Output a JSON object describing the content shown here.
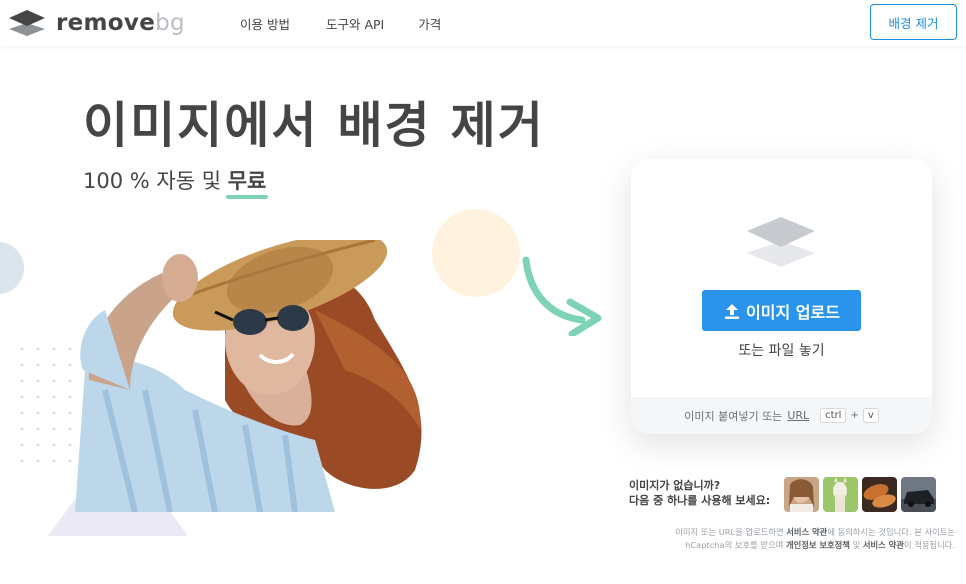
{
  "header": {
    "logo": {
      "word1": "remove",
      "word2": "bg"
    },
    "nav": [
      {
        "label": "이용 방법"
      },
      {
        "label": "도구와 API"
      },
      {
        "label": "가격"
      }
    ],
    "cta_label": "배경 제거"
  },
  "hero": {
    "title": "이미지에서 배경 제거",
    "subtitle_prefix": "100 % 자동 및 ",
    "subtitle_highlight": "무료"
  },
  "upload_card": {
    "upload_button_label": "이미지 업로드",
    "drop_text": "또는 파일 놓기",
    "paste_prefix": "이미지 붙여넣기 또는 ",
    "paste_url": "URL",
    "key_ctrl": "ctrl",
    "key_plus": "+",
    "key_v": "v"
  },
  "samples": {
    "line1": "이미지가 없습니까?",
    "line2": "다음 중 하나를 사용해 보세요:",
    "thumbs": [
      "woman",
      "llama",
      "bread",
      "car"
    ]
  },
  "legal": {
    "p1": "이미지 또는 URL을 업로드하면 ",
    "terms1": "서비스 약관",
    "p2": "에 동의하시는 것입니다. 본 사이트는",
    "p3": "hCaptcha의 보호를 받으며 ",
    "privacy": "개인정보 보호정책",
    "p4": " 및 ",
    "terms2": "서비스 약관",
    "p5": "이 적용됩니다."
  },
  "colors": {
    "accent": "#2a93ec",
    "text": "#454545",
    "highlight": "#7dd3b4",
    "logo_muted": "#b9bec4"
  }
}
